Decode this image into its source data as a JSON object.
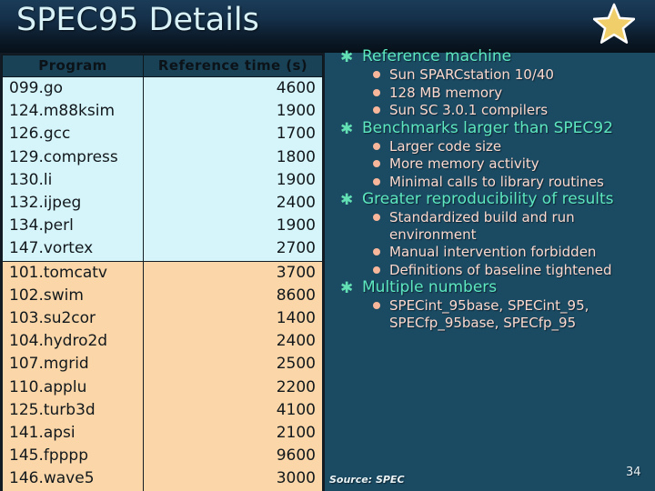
{
  "slide": {
    "title": "SPEC95 Details",
    "page_number": "34",
    "source_note": "Source: SPEC",
    "decor_icon": "star-icon",
    "colors": {
      "background_teal": "#1b4a63",
      "background_top": "#15304a",
      "title_text": "#d9f2f7",
      "star_fill": "#f0cf6b",
      "star_outline": "#ffffff",
      "table_header_bg": "#1a4257",
      "int_row_bg": "#d5f5fa",
      "fp_row_bg": "#fad6a8",
      "level1_text": "#5de8c0",
      "level2_text": "#fbd9ce",
      "level2_bullet": "#f8b79a"
    }
  },
  "table": {
    "headers": [
      "Program",
      "Reference time (s)"
    ],
    "int_rows": [
      {
        "program": "099.go",
        "time": "4600"
      },
      {
        "program": "124.m88ksim",
        "time": "1900"
      },
      {
        "program": "126.gcc",
        "time": "1700"
      },
      {
        "program": "129.compress",
        "time": "1800"
      },
      {
        "program": "130.li",
        "time": "1900"
      },
      {
        "program": "132.ijpeg",
        "time": "2400"
      },
      {
        "program": "134.perl",
        "time": "1900"
      },
      {
        "program": "147.vortex",
        "time": "2700"
      }
    ],
    "fp_rows": [
      {
        "program": "101.tomcatv",
        "time": "3700"
      },
      {
        "program": "102.swim",
        "time": "8600"
      },
      {
        "program": "103.su2cor",
        "time": "1400"
      },
      {
        "program": "104.hydro2d",
        "time": "2400"
      },
      {
        "program": "107.mgrid",
        "time": "2500"
      },
      {
        "program": "110.applu",
        "time": "2200"
      },
      {
        "program": "125.turb3d",
        "time": "4100"
      },
      {
        "program": "141.apsi",
        "time": "2100"
      },
      {
        "program": "145.fpppp",
        "time": "9600"
      },
      {
        "program": "146.wave5",
        "time": "3000"
      }
    ]
  },
  "bullets": [
    {
      "text": "Reference machine",
      "marker": "asterisk-bullet",
      "children": [
        "Sun SPARCstation 10/40",
        "128 MB memory",
        "Sun SC 3.0.1 compilers"
      ]
    },
    {
      "text": "Benchmarks larger than SPEC92",
      "marker": "asterisk-bullet",
      "children": [
        "Larger code size",
        "More memory activity",
        "Minimal calls to library routines"
      ]
    },
    {
      "text": "Greater reproducibility of results",
      "marker": "asterisk-bullet",
      "children": [
        "Standardized build and run environment",
        "Manual intervention forbidden",
        "Definitions of baseline tightened"
      ]
    },
    {
      "text": "Multiple numbers",
      "marker": "asterisk-bullet",
      "children": [
        "SPECint_95base, SPECint_95, SPECfp_95base, SPECfp_95"
      ]
    }
  ]
}
